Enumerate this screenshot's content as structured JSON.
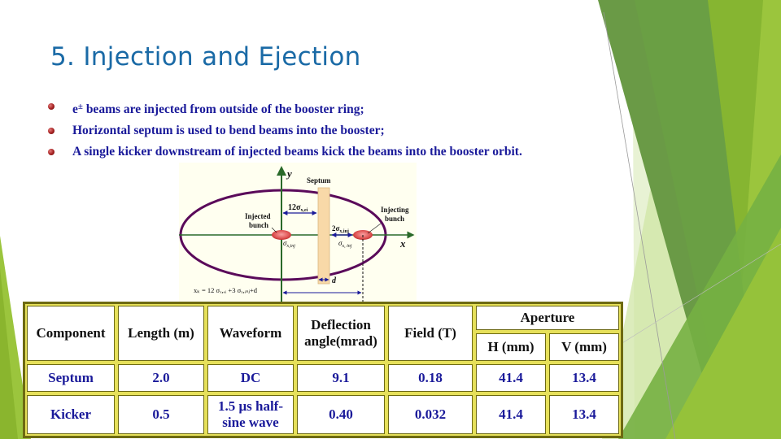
{
  "slide": {
    "title": "5. Injection and Ejection",
    "bullets": [
      {
        "prefix": "e",
        "superscript": "±",
        "text": " beams are injected from outside of the booster ring;"
      },
      {
        "prefix": "",
        "superscript": "",
        "text": "Horizontal septum is used to bend beams into the booster;"
      },
      {
        "prefix": "",
        "superscript": "",
        "text": "A single kicker downstream of injected beams kick the beams into the booster orbit."
      }
    ],
    "bullet_icon": "sphere-bullet-icon",
    "colors": {
      "title": "#1a6aa6",
      "body_text": "#1a1a9a",
      "table_border": "#6d6a12",
      "table_inner_border": "#e6e05a",
      "deco_green_dark": "#6a9a46",
      "deco_green_mid": "#86b531",
      "deco_green_light": "#9bc53d",
      "diagram_bg": "#fffff0",
      "orbit_ellipse": "#5a0a5a",
      "axis": "#2a6a2a",
      "septum_fill": "#f8d9a8",
      "bunch_fill": "#e05555",
      "dimension_arrow": "#1a1a9a"
    }
  },
  "diagram": {
    "y_axis_label": "y",
    "x_axis_label": "x",
    "septum_label": "Septum",
    "injected_bunch_label_1": "Injected",
    "injected_bunch_label_2": "bunch",
    "injecting_bunch_label_1": "Injecting",
    "injecting_bunch_label_2": "bunch",
    "dim_12sigma": "12σ",
    "dim_12sigma_sub": "x,ei",
    "dim_2sigma": "2σ",
    "dim_2sigma_sub": "x,inj",
    "sigma_injected": "σ",
    "sigma_injected_sub": "x,inj",
    "sigma_injecting": "σ",
    "sigma_injecting_sub": "x, inj",
    "d_label": "d",
    "formula": "xₖ = 12 σₓ,ₑᵢ +3 σₓ,ᵢₙⱼ+d"
  },
  "table": {
    "headers": {
      "component": "Component",
      "length": "Length (m)",
      "waveform": "Waveform",
      "deflection_1": "Deflection",
      "deflection_2": "angle(mrad)",
      "field": "Field (T)",
      "aperture": "Aperture",
      "aperture_h": "H (mm)",
      "aperture_v": "V (mm)"
    },
    "rows": [
      {
        "component": "Septum",
        "length": "2.0",
        "waveform_1": "DC",
        "waveform_2": "",
        "deflection": "9.1",
        "field": "0.18",
        "h": "41.4",
        "v": "13.4"
      },
      {
        "component": "Kicker",
        "length": "0.5",
        "waveform_1": "1.5 μs half-",
        "waveform_2": "sine wave",
        "deflection": "0.40",
        "field": "0.032",
        "h": "41.4",
        "v": "13.4"
      }
    ]
  }
}
